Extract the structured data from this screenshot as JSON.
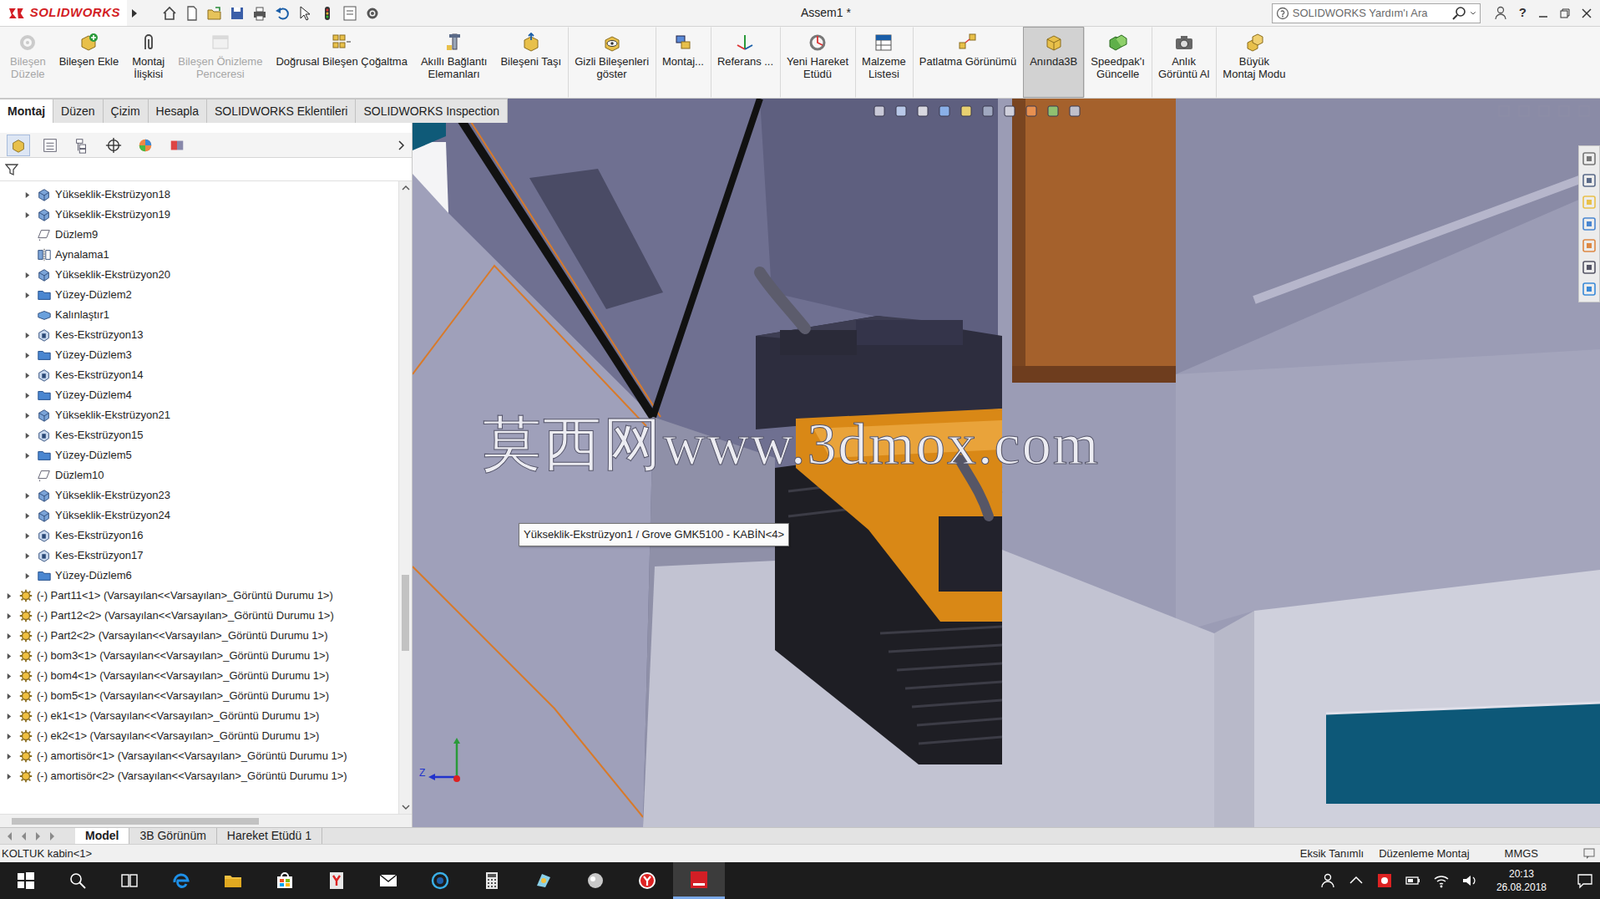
{
  "app": {
    "logo": "SOLIDWORKS"
  },
  "window": {
    "title": "Assem1 *"
  },
  "search": {
    "placeholder": "SOLIDWORKS Yardım'ı Ara"
  },
  "help": "?",
  "ribbon": [
    {
      "lines": [
        "Bileşen",
        "Düzele"
      ],
      "disabled": true,
      "selected": false
    },
    {
      "lines": [
        "Bileşen Ekle"
      ],
      "disabled": false,
      "selected": false
    },
    {
      "lines": [
        "Montaj",
        "İlişkisi"
      ],
      "disabled": false,
      "selected": false
    },
    {
      "lines": [
        "Bileşen Önizleme",
        "Penceresi"
      ],
      "disabled": true,
      "selected": false
    },
    {
      "lines": [
        "Doğrusal Bileşen Çoğaltma"
      ],
      "disabled": false,
      "selected": false
    },
    {
      "lines": [
        "Akıllı Bağlantı",
        "Elemanları"
      ],
      "disabled": false,
      "selected": false
    },
    {
      "lines": [
        "Bileşeni Taşı"
      ],
      "disabled": false,
      "selected": false
    },
    {
      "lines": [
        "Gizli Bileşenleri",
        "göster"
      ],
      "disabled": false,
      "selected": false
    },
    {
      "lines": [
        "Montaj..."
      ],
      "disabled": false,
      "selected": false
    },
    {
      "lines": [
        "Referans ..."
      ],
      "disabled": false,
      "selected": false
    },
    {
      "lines": [
        "Yeni Hareket",
        "Etüdü"
      ],
      "disabled": false,
      "selected": false
    },
    {
      "lines": [
        "Malzeme",
        "Listesi"
      ],
      "disabled": false,
      "selected": false
    },
    {
      "lines": [
        "Patlatma Görünümü"
      ],
      "disabled": false,
      "selected": false
    },
    {
      "lines": [
        "Anında3B"
      ],
      "disabled": false,
      "selected": true
    },
    {
      "lines": [
        "Speedpak'ı",
        "Güncelle"
      ],
      "disabled": false,
      "selected": false
    },
    {
      "lines": [
        "Anlık",
        "Görüntü Al"
      ],
      "disabled": false,
      "selected": false
    },
    {
      "lines": [
        "Büyük",
        "Montaj Modu"
      ],
      "disabled": false,
      "selected": false
    }
  ],
  "command_tabs": [
    {
      "label": "Montaj",
      "selected": true
    },
    {
      "label": "Düzen",
      "selected": false
    },
    {
      "label": "Çizim",
      "selected": false
    },
    {
      "label": "Hesapla",
      "selected": false
    },
    {
      "label": "SOLIDWORKS Eklentileri",
      "selected": false
    },
    {
      "label": "SOLIDWORKS Inspection",
      "selected": false
    }
  ],
  "tree": [
    {
      "label": "Yükseklik-Ekstrüzyon18",
      "kind": "extrude",
      "level": 1,
      "expander": true
    },
    {
      "label": "Yükseklik-Ekstrüzyon19",
      "kind": "extrude",
      "level": 1,
      "expander": true
    },
    {
      "label": "Düzlem9",
      "kind": "plane",
      "level": 1,
      "expander": false
    },
    {
      "label": "Aynalama1",
      "kind": "mirror",
      "level": 1,
      "expander": false
    },
    {
      "label": "Yükseklik-Ekstrüzyon20",
      "kind": "extrude",
      "level": 1,
      "expander": true
    },
    {
      "label": "Yüzey-Düzlem2",
      "kind": "surface",
      "level": 1,
      "expander": true
    },
    {
      "label": "Kalınlaştır1",
      "kind": "thicken",
      "level": 1,
      "expander": false
    },
    {
      "label": "Kes-Ekstrüzyon13",
      "kind": "cut",
      "level": 1,
      "expander": true
    },
    {
      "label": "Yüzey-Düzlem3",
      "kind": "surface",
      "level": 1,
      "expander": true
    },
    {
      "label": "Kes-Ekstrüzyon14",
      "kind": "cut",
      "level": 1,
      "expander": true
    },
    {
      "label": "Yüzey-Düzlem4",
      "kind": "surface",
      "level": 1,
      "expander": true
    },
    {
      "label": "Yükseklik-Ekstrüzyon21",
      "kind": "extrude",
      "level": 1,
      "expander": true
    },
    {
      "label": "Kes-Ekstrüzyon15",
      "kind": "cut",
      "level": 1,
      "expander": true
    },
    {
      "label": "Yüzey-Düzlem5",
      "kind": "surface",
      "level": 1,
      "expander": true
    },
    {
      "label": "Düzlem10",
      "kind": "plane",
      "level": 1,
      "expander": false
    },
    {
      "label": "Yükseklik-Ekstrüzyon23",
      "kind": "extrude",
      "level": 1,
      "expander": true
    },
    {
      "label": "Yükseklik-Ekstrüzyon24",
      "kind": "extrude",
      "level": 1,
      "expander": true
    },
    {
      "label": "Kes-Ekstrüzyon16",
      "kind": "cut",
      "level": 1,
      "expander": true
    },
    {
      "label": "Kes-Ekstrüzyon17",
      "kind": "cut",
      "level": 1,
      "expander": true
    },
    {
      "label": "Yüzey-Düzlem6",
      "kind": "surface",
      "level": 1,
      "expander": true
    },
    {
      "label": "(-) Part11<1> (Varsayılan<<Varsayılan>_Görüntü Durumu 1>)",
      "kind": "component",
      "level": 0,
      "expander": true
    },
    {
      "label": "(-) Part12<2> (Varsayılan<<Varsayılan>_Görüntü Durumu 1>)",
      "kind": "component",
      "level": 0,
      "expander": true
    },
    {
      "label": "(-) Part2<2> (Varsayılan<<Varsayılan>_Görüntü Durumu 1>)",
      "kind": "component",
      "level": 0,
      "expander": true
    },
    {
      "label": "(-) bom3<1> (Varsayılan<<Varsayılan>_Görüntü Durumu 1>)",
      "kind": "component",
      "level": 0,
      "expander": true
    },
    {
      "label": "(-) bom4<1> (Varsayılan<<Varsayılan>_Görüntü Durumu 1>)",
      "kind": "component",
      "level": 0,
      "expander": true
    },
    {
      "label": "(-) bom5<1> (Varsayılan<<Varsayılan>_Görüntü Durumu 1>)",
      "kind": "component",
      "level": 0,
      "expander": true
    },
    {
      "label": "(-) ek1<1> (Varsayılan<<Varsayılan>_Görüntü Durumu 1>)",
      "kind": "component",
      "level": 0,
      "expander": true
    },
    {
      "label": "(-) ek2<1> (Varsayılan<<Varsayılan>_Görüntü Durumu 1>)",
      "kind": "component",
      "level": 0,
      "expander": true
    },
    {
      "label": "(-) amortisör<1> (Varsayılan<<Varsayılan>_Görüntü Durumu 1>)",
      "kind": "component",
      "level": 0,
      "expander": true
    },
    {
      "label": "(-) amortisör<2> (Varsayılan<<Varsayılan>_Görüntü Durumu 1>)",
      "kind": "component",
      "level": 0,
      "expander": true
    }
  ],
  "tree_scroll": {
    "level": 0.7
  },
  "tree_hscroll": {
    "level": 0
  },
  "viewport": {
    "watermark": "莫西网www.3dmox.com",
    "tooltip": "Yükseklik-Ekstrüzyon1 / Grove GMK5100 - KABİN<4>",
    "triad_label": "Z"
  },
  "bottom_tabs": [
    {
      "label": "Model",
      "selected": true
    },
    {
      "label": "3B Görünüm",
      "selected": false
    },
    {
      "label": "Hareket Etüdü 1",
      "selected": false
    }
  ],
  "status_bar": {
    "left": "KOLTUK kabin<1>",
    "items": [
      "Eksik Tanımlı",
      "Düzenleme Montaj",
      "MMGS"
    ]
  },
  "taskbar": {
    "time": "20:13",
    "date": "26.08.2018"
  }
}
